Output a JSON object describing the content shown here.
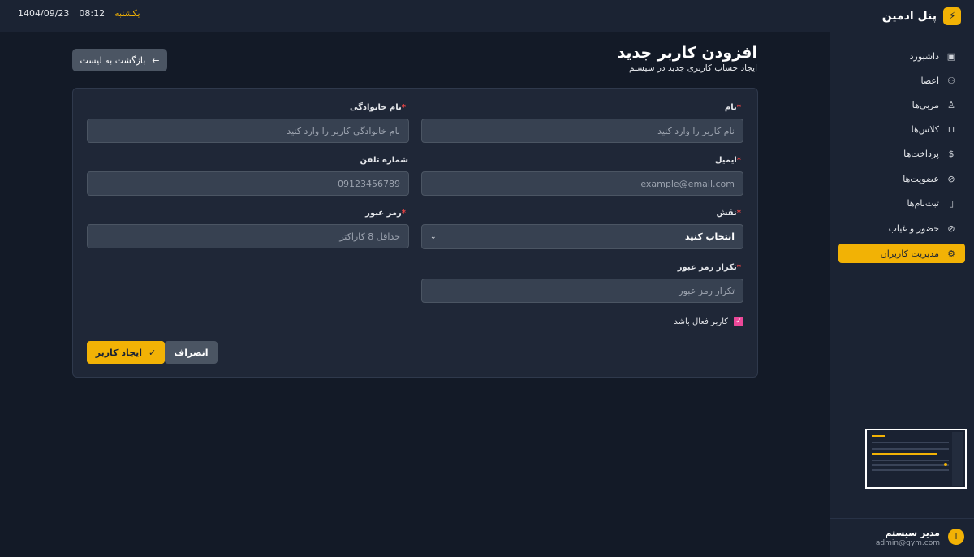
{
  "topbar": {
    "brand_title": "پنل ادمین",
    "brand_icon": "lightning-icon",
    "day": "یکشنبه",
    "time": "08:12",
    "date": "1404/09/23"
  },
  "sidebar": {
    "items": [
      {
        "label": "داشبورد",
        "icon": "briefcase-icon",
        "glyph": "▣",
        "active": false
      },
      {
        "label": "اعضا",
        "icon": "users-icon",
        "glyph": "⚇",
        "active": false
      },
      {
        "label": "مربی‌ها",
        "icon": "user-icon",
        "glyph": "♙",
        "active": false
      },
      {
        "label": "کلاس‌ها",
        "icon": "bag-icon",
        "glyph": "⊓",
        "active": false
      },
      {
        "label": "پرداخت‌ها",
        "icon": "dollar-icon",
        "glyph": "$",
        "active": false
      },
      {
        "label": "عضویت‌ها",
        "icon": "check-circle-icon",
        "glyph": "⊘",
        "active": false
      },
      {
        "label": "ثبت‌نام‌ها",
        "icon": "clipboard-icon",
        "glyph": "▯",
        "active": false
      },
      {
        "label": "حضور و غیاب",
        "icon": "check-circle-icon",
        "glyph": "⊘",
        "active": false
      },
      {
        "label": "مدیریت کاربران",
        "icon": "user-cog-icon",
        "glyph": "⚙",
        "active": true
      }
    ],
    "user": {
      "initial": "ا",
      "name": "مدیر سیستم",
      "email": "admin@gym.com"
    }
  },
  "page": {
    "title": "افزودن کاربر جدید",
    "subtitle": "ایجاد حساب کاربری جدید در سیستم",
    "back_label": "بازگشت به لیست",
    "back_icon": "arrow-left-icon"
  },
  "form": {
    "required_mark": "*",
    "first_name": {
      "label": "نام",
      "placeholder": "نام کاربر را وارد کنید"
    },
    "last_name": {
      "label": "نام خانوادگی",
      "placeholder": "نام خانوادگی کاربر را وارد کنید"
    },
    "email": {
      "label": "ایمیل",
      "placeholder": "example@email.com"
    },
    "phone": {
      "label": "شماره تلفن",
      "placeholder": "09123456789"
    },
    "role": {
      "label": "نقش",
      "selected": "انتخاب کنید"
    },
    "password": {
      "label": "رمز عبور",
      "placeholder": "حداقل 8 کاراکتر"
    },
    "password_confirm": {
      "label": "تکرار رمز عبور",
      "placeholder": "تکرار رمز عبور"
    },
    "active_checkbox": {
      "label": "کاربر فعال باشد",
      "checked": true
    },
    "create_label": "ایجاد کاربر",
    "cancel_label": "انصراف"
  },
  "colors": {
    "accent": "#f2b205",
    "background": "#131a27",
    "panel": "#1f2737",
    "checkbox": "#ec4899",
    "required": "#ef4444"
  }
}
